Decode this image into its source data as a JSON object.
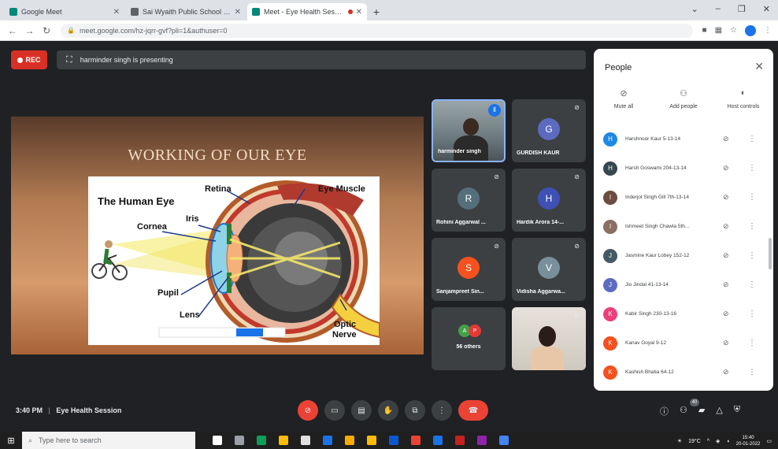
{
  "browser": {
    "tabs": [
      {
        "title": "Google Meet",
        "active": false
      },
      {
        "title": "Sai Wyaith Public School - Class",
        "active": false
      },
      {
        "title": "Meet - Eye Health Session",
        "active": true
      }
    ],
    "new_tab": "+",
    "url": "meet.google.com/hz-jqrr-gvf?pli=1&authuser=0",
    "window_controls": [
      "⌄",
      "–",
      "❐",
      "✕"
    ]
  },
  "meet": {
    "rec_label": "REC",
    "presenting_text": "harminder singh is presenting",
    "meeting_time": "3:40 PM",
    "separator": "|",
    "meeting_name": "Eye Health Session",
    "participant_count": "40"
  },
  "slide": {
    "title": "WORKING OF OUR EYE",
    "labels": {
      "human_eye": "The Human Eye",
      "retina": "Retina",
      "eye_muscle": "Eye Muscle",
      "iris": "Iris",
      "cornea": "Cornea",
      "pupil": "Pupil",
      "lens": "Lens",
      "optic_nerve_1": "Optic",
      "optic_nerve_2": "Nerve"
    }
  },
  "tiles": [
    {
      "name": "harminder singh",
      "avatar": "",
      "color": "",
      "video": true
    },
    {
      "name": "GURDISH KAUR",
      "avatar": "G",
      "color": "#5c6bc0"
    },
    {
      "name": "Rohini Aggarwal ...",
      "avatar": "R",
      "color": "#546e7a"
    },
    {
      "name": "Hardik Arora 14-...",
      "avatar": "H",
      "color": "#3f51b5"
    },
    {
      "name": "Sanjampreet Sin...",
      "avatar": "S",
      "color": "#f4511e"
    },
    {
      "name": "Vidisha Aggarwa...",
      "avatar": "V",
      "color": "#78909c"
    },
    {
      "name": "56 others",
      "avatar": "",
      "color": ""
    },
    {
      "name": "",
      "avatar": "",
      "color": "",
      "video": true
    }
  ],
  "others_avatars": [
    {
      "letter": "A",
      "color": "#43a047"
    },
    {
      "letter": "P",
      "color": "#e53935"
    }
  ],
  "people_panel": {
    "title": "People",
    "close": "✕",
    "actions": [
      {
        "label": "Mute all",
        "icon": "mic-off-icon"
      },
      {
        "label": "Add people",
        "icon": "add-person-icon"
      },
      {
        "label": "Host controls",
        "icon": "toggle-icon"
      }
    ],
    "people": [
      {
        "name": "Harshnoor Kaur 5-13-14",
        "avatar": "H",
        "color": "#1e88e5"
      },
      {
        "name": "Harsh Goswami 204-13-14",
        "avatar": "H",
        "color": "#37474f"
      },
      {
        "name": "Inderjot Singh Gill 7th-13-14",
        "avatar": "I",
        "color": "#6d4c41"
      },
      {
        "name": "Ishmeet Singh Chawla 5th...",
        "avatar": "I",
        "color": "#8d6e63"
      },
      {
        "name": "Jasmine Kaur Lobey 152-12",
        "avatar": "J",
        "color": "#455a64"
      },
      {
        "name": "Jio Jindal 41-13-14",
        "avatar": "J",
        "color": "#5c6bc0"
      },
      {
        "name": "Kabir Singh 230-13-16",
        "avatar": "K",
        "color": "#ec407a"
      },
      {
        "name": "Kanav Goyal 9-12",
        "avatar": "K",
        "color": "#f4511e"
      },
      {
        "name": "Kashish Bhatia 64-12",
        "avatar": "K",
        "color": "#f4511e"
      }
    ]
  },
  "taskbar": {
    "search_placeholder": "Type here to search",
    "weather": "19°C",
    "time": "15:40",
    "date": "20-01-2022"
  }
}
